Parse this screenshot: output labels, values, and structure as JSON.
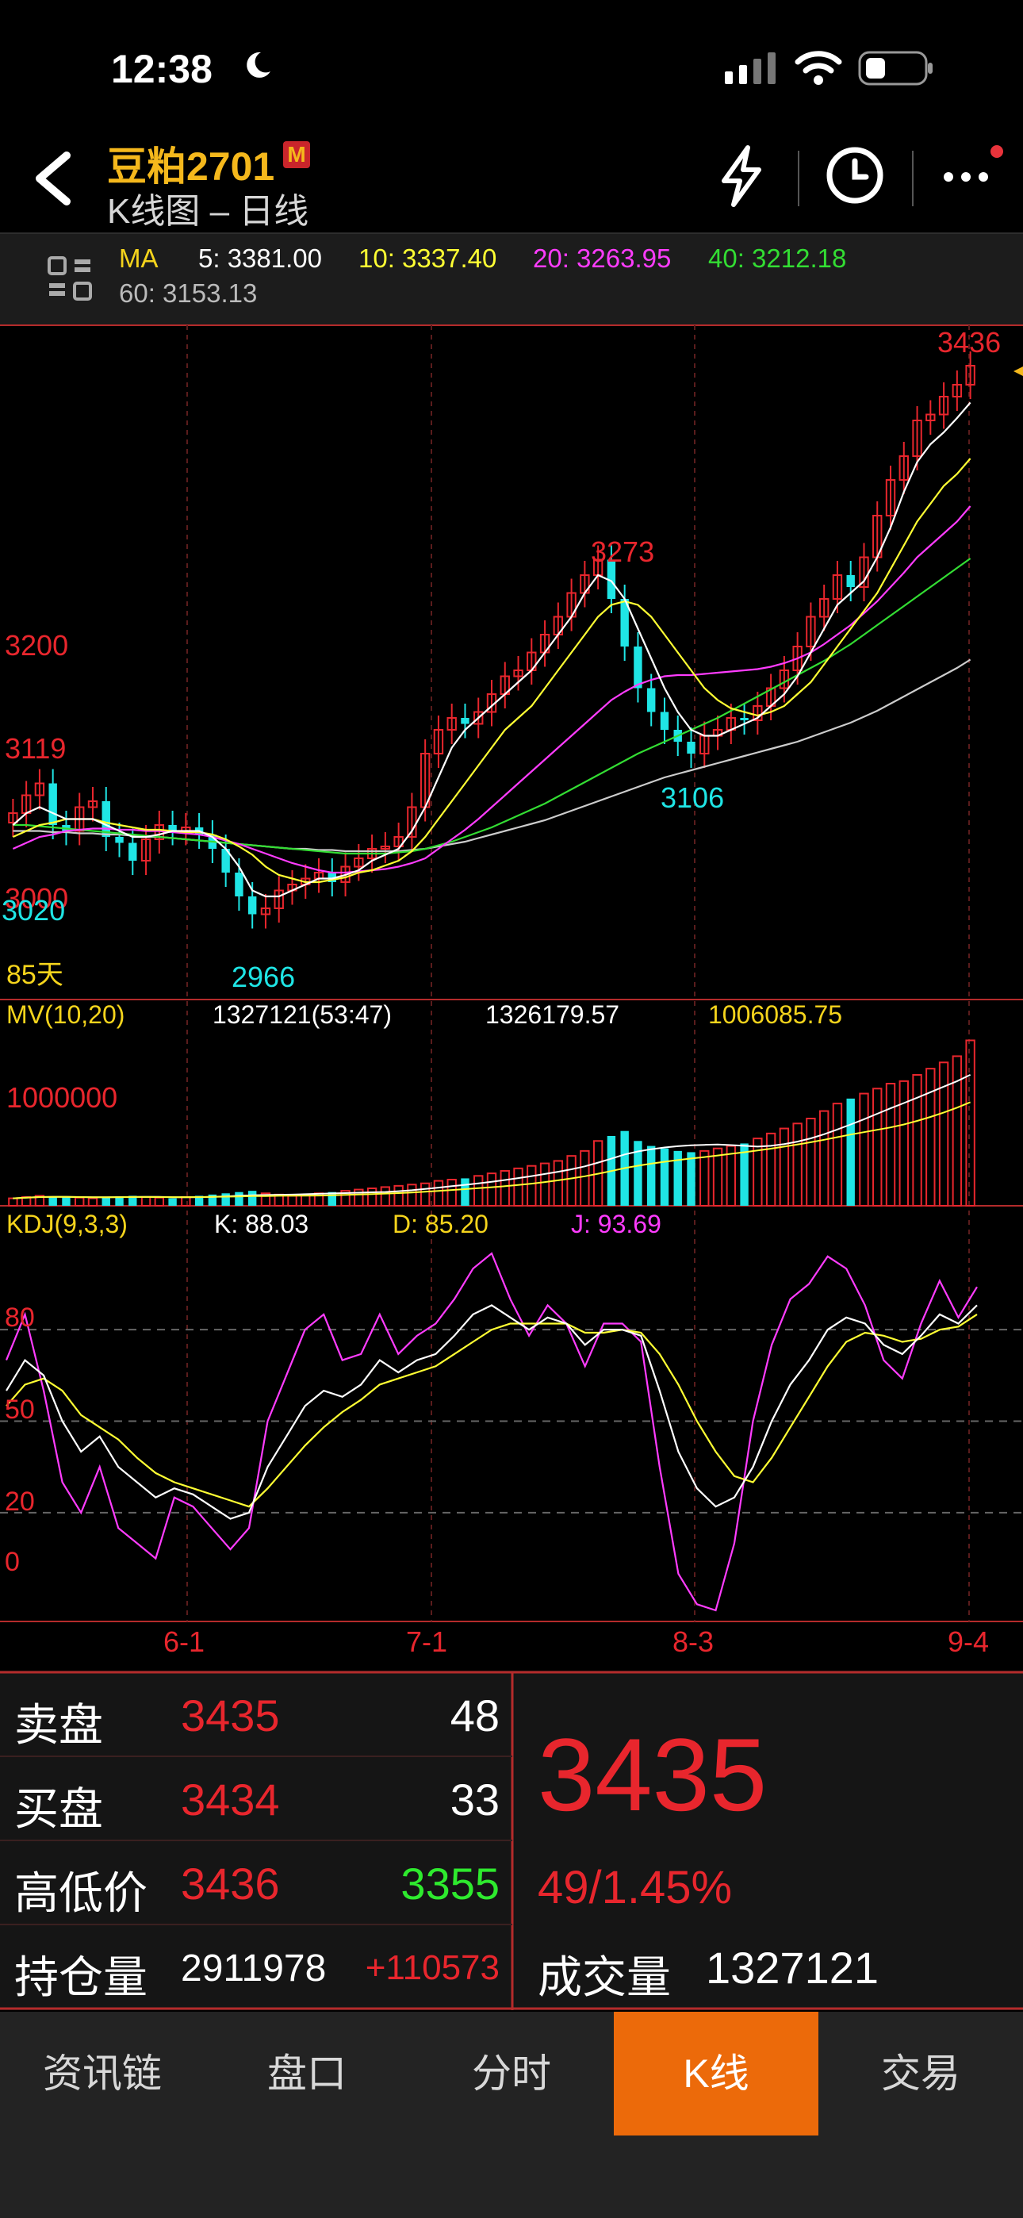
{
  "status_bar": {
    "time": "12:38"
  },
  "header": {
    "title": "豆粕2701",
    "badge": "M",
    "subtitle": "K线图 – 日线"
  },
  "ma": {
    "label": "MA",
    "ma5": "5: 3381.00",
    "ma10": "10: 3337.40",
    "ma20": "20: 3263.95",
    "ma40": "40: 3212.18",
    "ma60": "60: 3153.13",
    "colors": {
      "ma5": "#ffffff",
      "ma10": "#ffff33",
      "ma20": "#ff3cff",
      "ma40": "#33dd33",
      "ma60": "#cccccc"
    }
  },
  "kline": {
    "price_labels": [
      "3200",
      "3119",
      "3000",
      "3020"
    ],
    "high_label": "3436",
    "peak_label": "3273",
    "low_label_1": "2966",
    "low_label_2": "3106",
    "days_label": "85天",
    "close_prices": [
      3060,
      3075,
      3085,
      3050,
      3045,
      3065,
      3070,
      3040,
      3035,
      3020,
      3038,
      3050,
      3045,
      3048,
      3042,
      3030,
      3010,
      2990,
      2975,
      2980,
      2995,
      3000,
      3005,
      3010,
      3002,
      3015,
      3022,
      3030,
      3032,
      3040,
      3065,
      3110,
      3130,
      3140,
      3135,
      3145,
      3160,
      3175,
      3180,
      3195,
      3210,
      3225,
      3245,
      3260,
      3273,
      3240,
      3200,
      3165,
      3145,
      3130,
      3120,
      3110,
      3125,
      3130,
      3140,
      3138,
      3150,
      3165,
      3180,
      3200,
      3225,
      3240,
      3260,
      3250,
      3275,
      3310,
      3340,
      3360,
      3390,
      3395,
      3410,
      3420,
      3436
    ],
    "ma5": [
      3050,
      3060,
      3065,
      3060,
      3055,
      3055,
      3055,
      3050,
      3045,
      3040,
      3040,
      3042,
      3045,
      3045,
      3045,
      3040,
      3030,
      3015,
      2995,
      2990,
      2990,
      2995,
      3000,
      3005,
      3005,
      3008,
      3012,
      3020,
      3025,
      3030,
      3045,
      3065,
      3090,
      3115,
      3130,
      3140,
      3150,
      3160,
      3170,
      3180,
      3195,
      3210,
      3225,
      3245,
      3260,
      3255,
      3240,
      3215,
      3190,
      3165,
      3145,
      3130,
      3125,
      3125,
      3130,
      3135,
      3140,
      3150,
      3160,
      3175,
      3195,
      3215,
      3235,
      3245,
      3255,
      3275,
      3300,
      3330,
      3355,
      3370,
      3380,
      3392,
      3405
    ],
    "ma10": [
      3040,
      3045,
      3050,
      3052,
      3055,
      3055,
      3055,
      3052,
      3050,
      3048,
      3046,
      3046,
      3045,
      3044,
      3044,
      3042,
      3038,
      3032,
      3025,
      3015,
      3008,
      3005,
      3002,
      3002,
      3004,
      3006,
      3010,
      3012,
      3016,
      3020,
      3028,
      3040,
      3055,
      3070,
      3085,
      3100,
      3115,
      3130,
      3140,
      3150,
      3165,
      3180,
      3195,
      3210,
      3225,
      3235,
      3238,
      3235,
      3225,
      3210,
      3195,
      3180,
      3165,
      3155,
      3148,
      3145,
      3142,
      3145,
      3150,
      3160,
      3170,
      3185,
      3200,
      3215,
      3230,
      3245,
      3265,
      3285,
      3305,
      3320,
      3335,
      3345,
      3358
    ],
    "ma20": [
      3030,
      3035,
      3040,
      3042,
      3045,
      3046,
      3047,
      3047,
      3046,
      3046,
      3045,
      3045,
      3044,
      3043,
      3042,
      3040,
      3037,
      3034,
      3030,
      3026,
      3022,
      3018,
      3015,
      3012,
      3010,
      3010,
      3011,
      3012,
      3013,
      3015,
      3018,
      3022,
      3030,
      3038,
      3046,
      3055,
      3065,
      3075,
      3085,
      3095,
      3105,
      3115,
      3125,
      3135,
      3145,
      3155,
      3162,
      3168,
      3172,
      3175,
      3176,
      3176,
      3177,
      3178,
      3179,
      3180,
      3181,
      3183,
      3186,
      3190,
      3195,
      3202,
      3210,
      3218,
      3228,
      3238,
      3250,
      3262,
      3275,
      3285,
      3295,
      3305,
      3318
    ],
    "ma40": [
      3050,
      3050,
      3049,
      3048,
      3047,
      3046,
      3045,
      3044,
      3043,
      3042,
      3041,
      3040,
      3039,
      3038,
      3037,
      3036,
      3035,
      3034,
      3033,
      3032,
      3031,
      3030,
      3029,
      3028,
      3027,
      3026,
      3026,
      3026,
      3026,
      3027,
      3028,
      3030,
      3033,
      3036,
      3040,
      3044,
      3048,
      3053,
      3058,
      3063,
      3068,
      3074,
      3080,
      3086,
      3092,
      3098,
      3104,
      3110,
      3115,
      3120,
      3125,
      3130,
      3135,
      3140,
      3146,
      3152,
      3158,
      3164,
      3170,
      3176,
      3182,
      3188,
      3195,
      3202,
      3210,
      3218,
      3226,
      3234,
      3242,
      3250,
      3258,
      3266,
      3274
    ],
    "ma60": [
      3045,
      3045,
      3045,
      3044,
      3044,
      3043,
      3043,
      3042,
      3042,
      3041,
      3040,
      3040,
      3039,
      3038,
      3037,
      3036,
      3035,
      3034,
      3033,
      3032,
      3031,
      3030,
      3030,
      3029,
      3029,
      3028,
      3028,
      3028,
      3028,
      3028,
      3029,
      3030,
      3032,
      3034,
      3036,
      3039,
      3042,
      3045,
      3048,
      3051,
      3054,
      3058,
      3062,
      3066,
      3070,
      3074,
      3078,
      3082,
      3086,
      3090,
      3093,
      3096,
      3099,
      3102,
      3105,
      3108,
      3111,
      3114,
      3117,
      3120,
      3124,
      3128,
      3132,
      3136,
      3141,
      3146,
      3152,
      3158,
      3164,
      3170,
      3176,
      3182,
      3189
    ]
  },
  "volume": {
    "title": "MV(10,20)",
    "v1": "1327121(53:47)",
    "v2": "1326179.57",
    "v3": "1006085.75",
    "scale_label": "1000000",
    "values": [
      60,
      70,
      80,
      75,
      70,
      65,
      60,
      70,
      75,
      80,
      70,
      65,
      60,
      70,
      80,
      90,
      100,
      110,
      120,
      100,
      90,
      80,
      90,
      100,
      110,
      120,
      130,
      140,
      150,
      160,
      170,
      180,
      200,
      210,
      220,
      240,
      260,
      280,
      300,
      320,
      340,
      360,
      400,
      440,
      520,
      560,
      600,
      520,
      480,
      460,
      440,
      430,
      440,
      460,
      480,
      500,
      540,
      580,
      620,
      660,
      700,
      760,
      820,
      860,
      900,
      940,
      980,
      1000,
      1050,
      1100,
      1150,
      1200,
      1327
    ]
  },
  "kdj": {
    "title": "KDJ(9,3,3)",
    "k": "K: 88.03",
    "d": "D: 85.20",
    "j": "J: 93.69",
    "level_labels": [
      "80",
      "50",
      "20",
      "0"
    ],
    "k_values": [
      60,
      70,
      65,
      50,
      40,
      45,
      35,
      30,
      25,
      28,
      26,
      22,
      18,
      20,
      35,
      45,
      55,
      60,
      58,
      62,
      70,
      66,
      70,
      72,
      78,
      85,
      88,
      84,
      80,
      84,
      82,
      75,
      80,
      80,
      78,
      60,
      40,
      28,
      22,
      25,
      35,
      50,
      62,
      70,
      80,
      84,
      82,
      75,
      72,
      78,
      85,
      82,
      88
    ],
    "d_values": [
      55,
      62,
      64,
      60,
      52,
      48,
      44,
      38,
      33,
      30,
      28,
      26,
      24,
      22,
      28,
      35,
      42,
      48,
      53,
      57,
      62,
      64,
      66,
      68,
      72,
      76,
      80,
      82,
      82,
      82,
      82,
      79,
      79,
      80,
      79,
      72,
      62,
      50,
      40,
      32,
      30,
      38,
      48,
      58,
      68,
      76,
      79,
      78,
      76,
      77,
      80,
      81,
      85
    ],
    "j_values": [
      70,
      85,
      60,
      30,
      20,
      35,
      15,
      10,
      5,
      25,
      22,
      15,
      8,
      15,
      50,
      65,
      80,
      85,
      70,
      72,
      85,
      72,
      78,
      82,
      90,
      100,
      105,
      90,
      78,
      88,
      82,
      68,
      82,
      82,
      76,
      35,
      0,
      -10,
      -12,
      10,
      50,
      75,
      90,
      95,
      104,
      100,
      88,
      70,
      64,
      82,
      96,
      84,
      94
    ]
  },
  "x_axis": {
    "labels": [
      "6-1",
      "7-1",
      "8-3",
      "9-4"
    ]
  },
  "info": {
    "ask_label": "卖盘",
    "ask_price": "3435",
    "ask_qty": "48",
    "bid_label": "买盘",
    "bid_price": "3434",
    "bid_qty": "33",
    "hilo_label": "高低价",
    "high": "3436",
    "low": "3355",
    "oi_label": "持仓量",
    "oi": "2911978",
    "oi_change": "+110573",
    "last_price": "3435",
    "change": "49/1.45%",
    "volume_label": "成交量",
    "volume": "1327121"
  },
  "tabs": [
    "资讯链",
    "盘口",
    "分时",
    "K线",
    "交易"
  ],
  "active_tab": "K线",
  "colors": {
    "up": "#e8262d",
    "down": "#1fe5e5",
    "accent": "#ec6a0a",
    "title": "#f5b81c"
  }
}
